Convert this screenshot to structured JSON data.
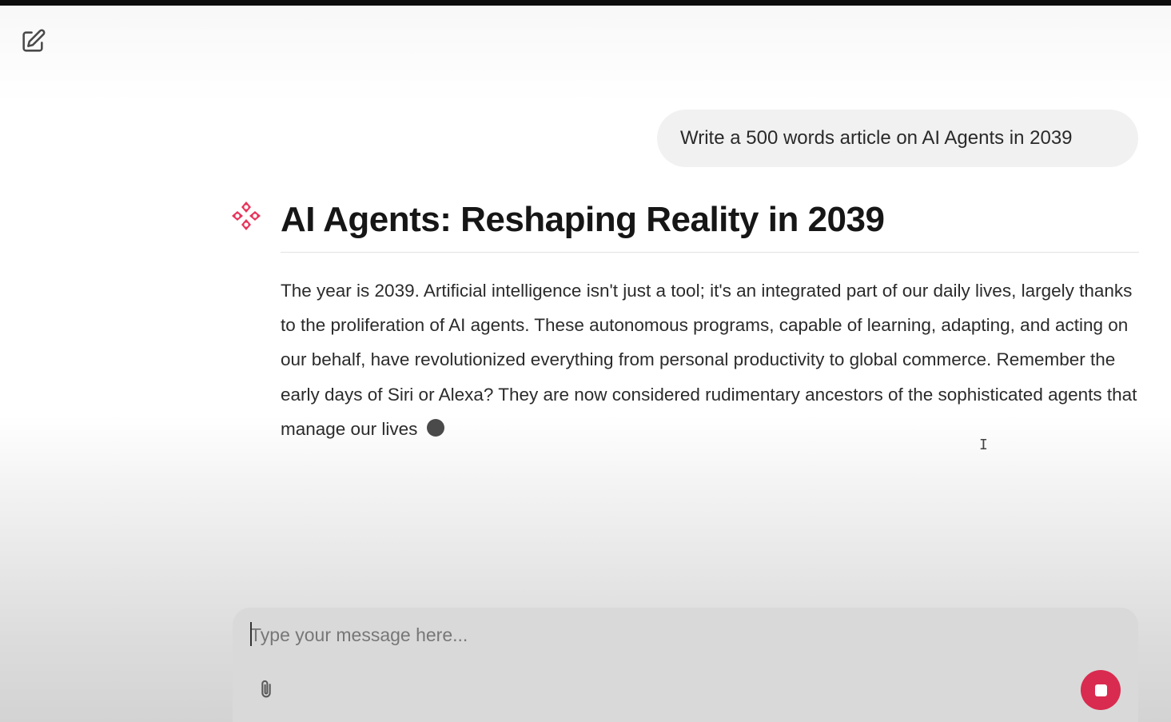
{
  "header": {
    "new_chat_icon": "edit-square-icon"
  },
  "conversation": {
    "user_message": "Write a 500 words article on AI Agents in 2039",
    "assistant": {
      "avatar_icon": "sparkle-icon",
      "avatar_color": "#e8335a",
      "title": "AI Agents: Reshaping Reality in 2039",
      "body": "The year is 2039.  Artificial intelligence isn't just a tool; it's an integrated part of our daily lives, largely thanks to the proliferation of AI agents.  These autonomous programs, capable of learning, adapting, and acting on our behalf, have revolutionized everything from personal productivity to global commerce.  Remember the early days of Siri or Alexa? They are now considered rudimentary ancestors of the sophisticated agents that manage our lives",
      "streaming_indicator": "typing-dot"
    }
  },
  "composer": {
    "placeholder": "Type your message here...",
    "attach_icon": "paperclip-icon",
    "stop_icon": "stop-icon",
    "stop_button_color": "#d92b4f"
  }
}
